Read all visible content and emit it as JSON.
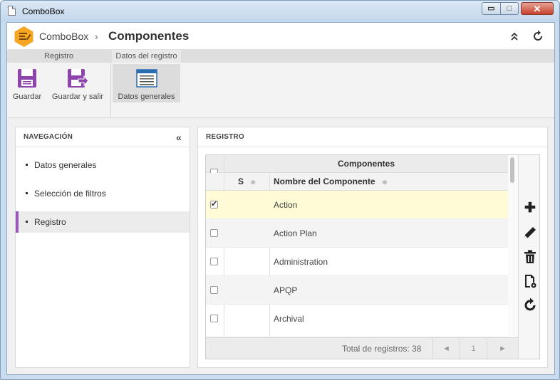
{
  "window": {
    "title": "ComboBox",
    "controls": {
      "minimize": "▭",
      "maximize": "□",
      "close": "✕"
    }
  },
  "header": {
    "app_name": "ComboBox",
    "separator": "›",
    "page_title": "Componentes",
    "logo_color": "#f5a623"
  },
  "ribbon": {
    "groups": [
      "Registro",
      "Datos del registro"
    ],
    "buttons": {
      "save": "Guardar",
      "save_exit": "Guardar y salir",
      "general_data": "Datos generales"
    },
    "accent": "#8e44ad"
  },
  "nav": {
    "title": "NAVEGACIÓN",
    "items": [
      "Datos generales",
      "Selección de filtros",
      "Registro"
    ],
    "active_index": 2,
    "active_color": "#9b59b6"
  },
  "registro": {
    "title": "REGISTRO",
    "grid": {
      "group_header": "Componentes",
      "columns": [
        "S",
        "Nombre del Componente"
      ],
      "rows": [
        {
          "name": "Action",
          "checked": true
        },
        {
          "name": "Action Plan",
          "checked": false
        },
        {
          "name": "Administration",
          "checked": false
        },
        {
          "name": "APQP",
          "checked": false
        },
        {
          "name": "Archival",
          "checked": false
        }
      ],
      "footer": {
        "total_label": "Total de registros: 38",
        "page": "1",
        "prev": "◄",
        "next": "►"
      }
    },
    "toolbar_icons": [
      "add-icon",
      "edit-icon",
      "delete-icon",
      "document-settings-icon",
      "refresh-icon"
    ]
  }
}
